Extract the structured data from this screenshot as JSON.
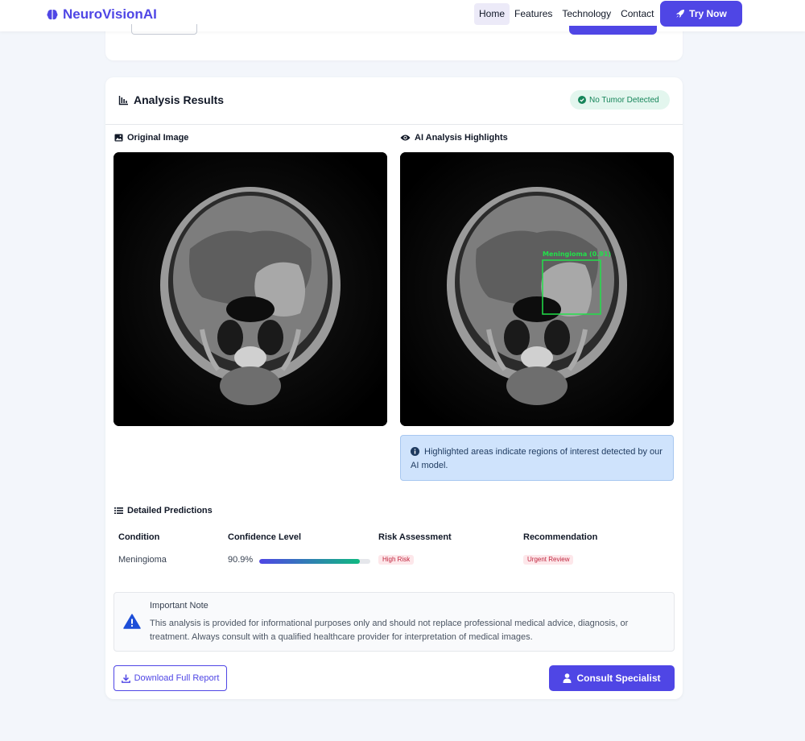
{
  "nav": {
    "brand": "NeuroVisionAI",
    "links": [
      "Home",
      "Features",
      "Technology",
      "Contact"
    ],
    "active": "Home",
    "cta": "Try Now"
  },
  "results": {
    "title": "Analysis Results",
    "status": "No Tumor Detected",
    "original_label": "Original Image",
    "highlight_label": "AI Analysis Highlights",
    "detection_label": "Meningioma (0.91)",
    "info_text": "Highlighted areas indicate regions of interest detected by our AI model."
  },
  "predictions": {
    "title": "Detailed Predictions",
    "headers": [
      "Condition",
      "Confidence Level",
      "Risk Assessment",
      "Recommendation"
    ],
    "row": {
      "condition": "Meningioma",
      "confidence": "90.9%",
      "confidence_value": 0.909,
      "risk": "High Risk",
      "recommendation": "Urgent Review"
    }
  },
  "note": {
    "title": "Important Note",
    "text": "This analysis is provided for informational purposes only and should not replace professional medical advice, diagnosis, or treatment. Always consult with a qualified healthcare provider for interpretation of medical images."
  },
  "actions": {
    "download": "Download Full Report",
    "consult": "Consult Specialist"
  },
  "colors": {
    "accent": "#4f46e5",
    "success": "#16855a",
    "danger": "#c0263f",
    "detection_box": "#22e04a"
  }
}
